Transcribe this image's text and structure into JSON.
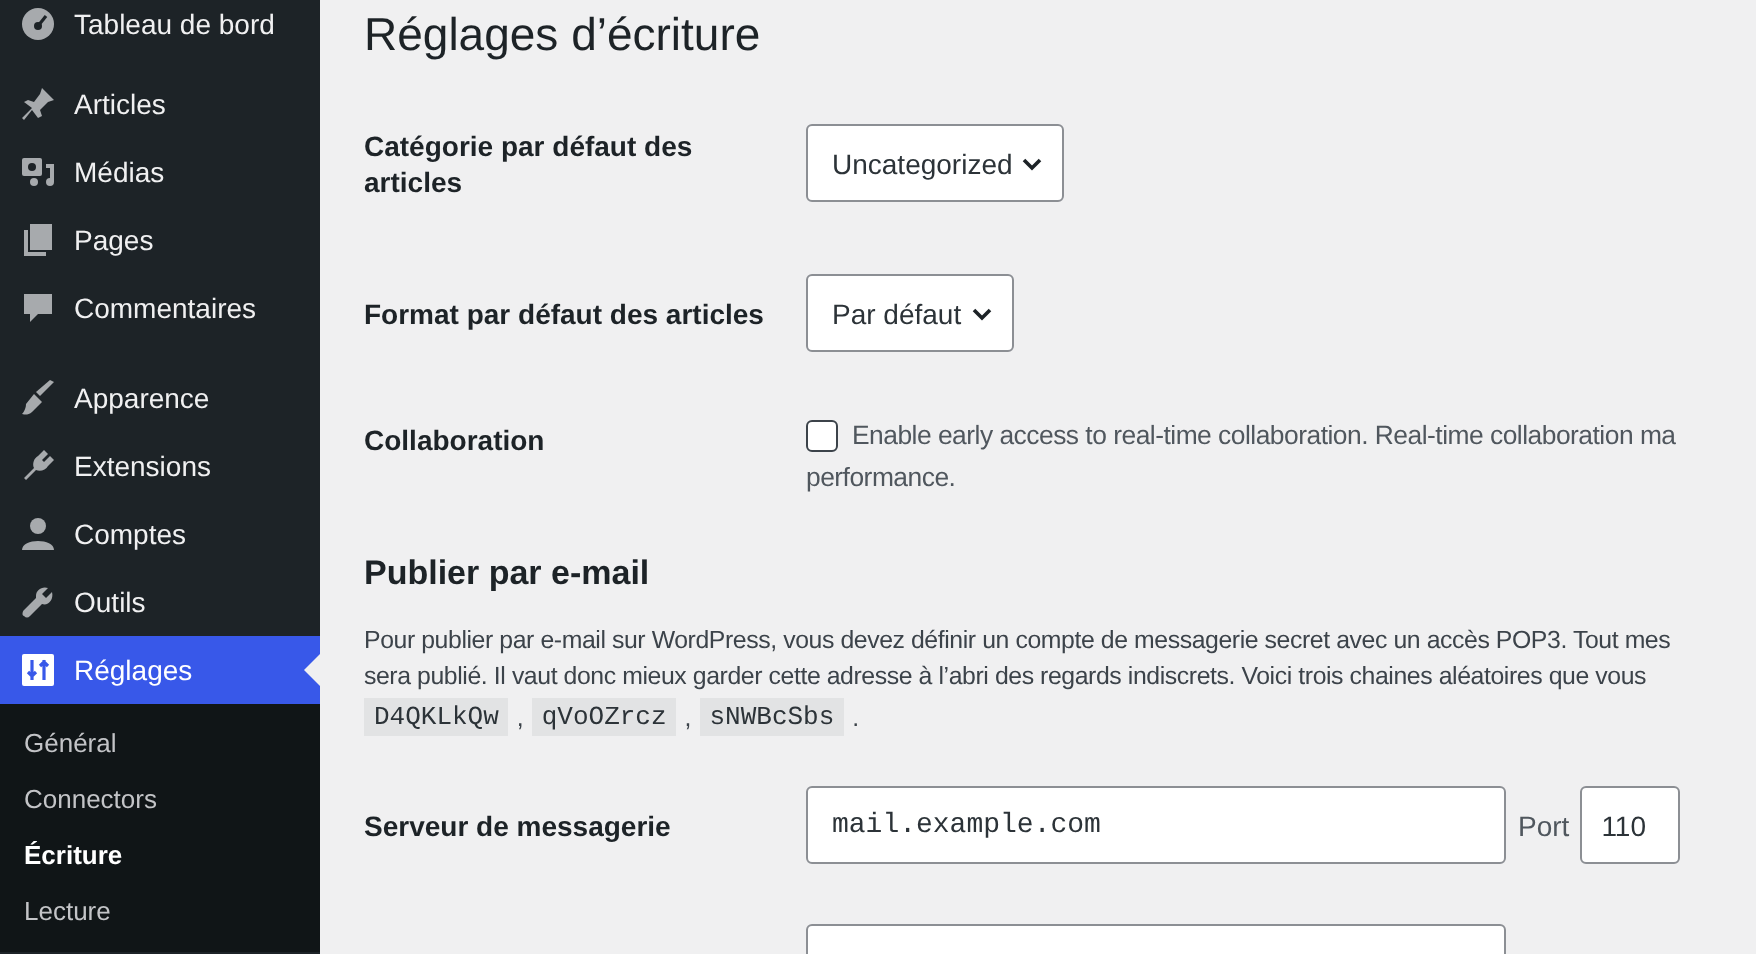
{
  "sidebar": {
    "groups": [
      {
        "items": [
          {
            "label": "Tableau de bord",
            "selected": false
          }
        ]
      },
      {
        "items": [
          {
            "label": "Articles",
            "selected": false
          },
          {
            "label": "Médias",
            "selected": false
          },
          {
            "label": "Pages",
            "selected": false
          },
          {
            "label": "Commentaires",
            "selected": false
          }
        ]
      },
      {
        "items": [
          {
            "label": "Apparence",
            "selected": false
          },
          {
            "label": "Extensions",
            "selected": false
          },
          {
            "label": "Comptes",
            "selected": false
          },
          {
            "label": "Outils",
            "selected": false
          },
          {
            "label": "Réglages",
            "selected": true,
            "children": [
              {
                "label": "Général",
                "selected": false
              },
              {
                "label": "Connectors",
                "selected": false
              },
              {
                "label": "Écriture",
                "selected": true
              },
              {
                "label": "Lecture",
                "selected": false
              }
            ]
          }
        ]
      }
    ]
  },
  "page": {
    "title": "Réglages d’écriture",
    "rows": [
      {
        "kind": "select",
        "label": "Catégorie par défaut des articles",
        "value": "Uncategorized"
      },
      {
        "kind": "select",
        "label": "Format par défaut des articles",
        "value": "Par défaut"
      },
      {
        "kind": "checkbox",
        "label": "Collaboration",
        "checked": false,
        "text_lines": [
          "Enable early access to real-time collaboration. Real-time collaboration ma",
          "performance."
        ]
      }
    ],
    "email_section": {
      "heading": "Publier par e-mail",
      "description_lines": [
        "Pour publier par e-mail sur WordPress, vous devez définir un compte de messagerie secret avec un accès POP3. Tout mes",
        "sera publié. Il vaut donc mieux garder cette adresse à l’abri des regards indiscrets. Voici trois chaines aléatoires que vous"
      ],
      "codes": [
        "D4QKLkQw",
        "qVoOZrcz",
        "sNWBcSbs"
      ],
      "code_separators": [
        ",",
        ",",
        "."
      ]
    },
    "server_rows": [
      {
        "kind": "server",
        "label": "Serveur de messagerie",
        "value": "mail.example.com",
        "port_label": "Port",
        "port_value": "110"
      },
      {
        "kind": "text-input"
      }
    ]
  }
}
